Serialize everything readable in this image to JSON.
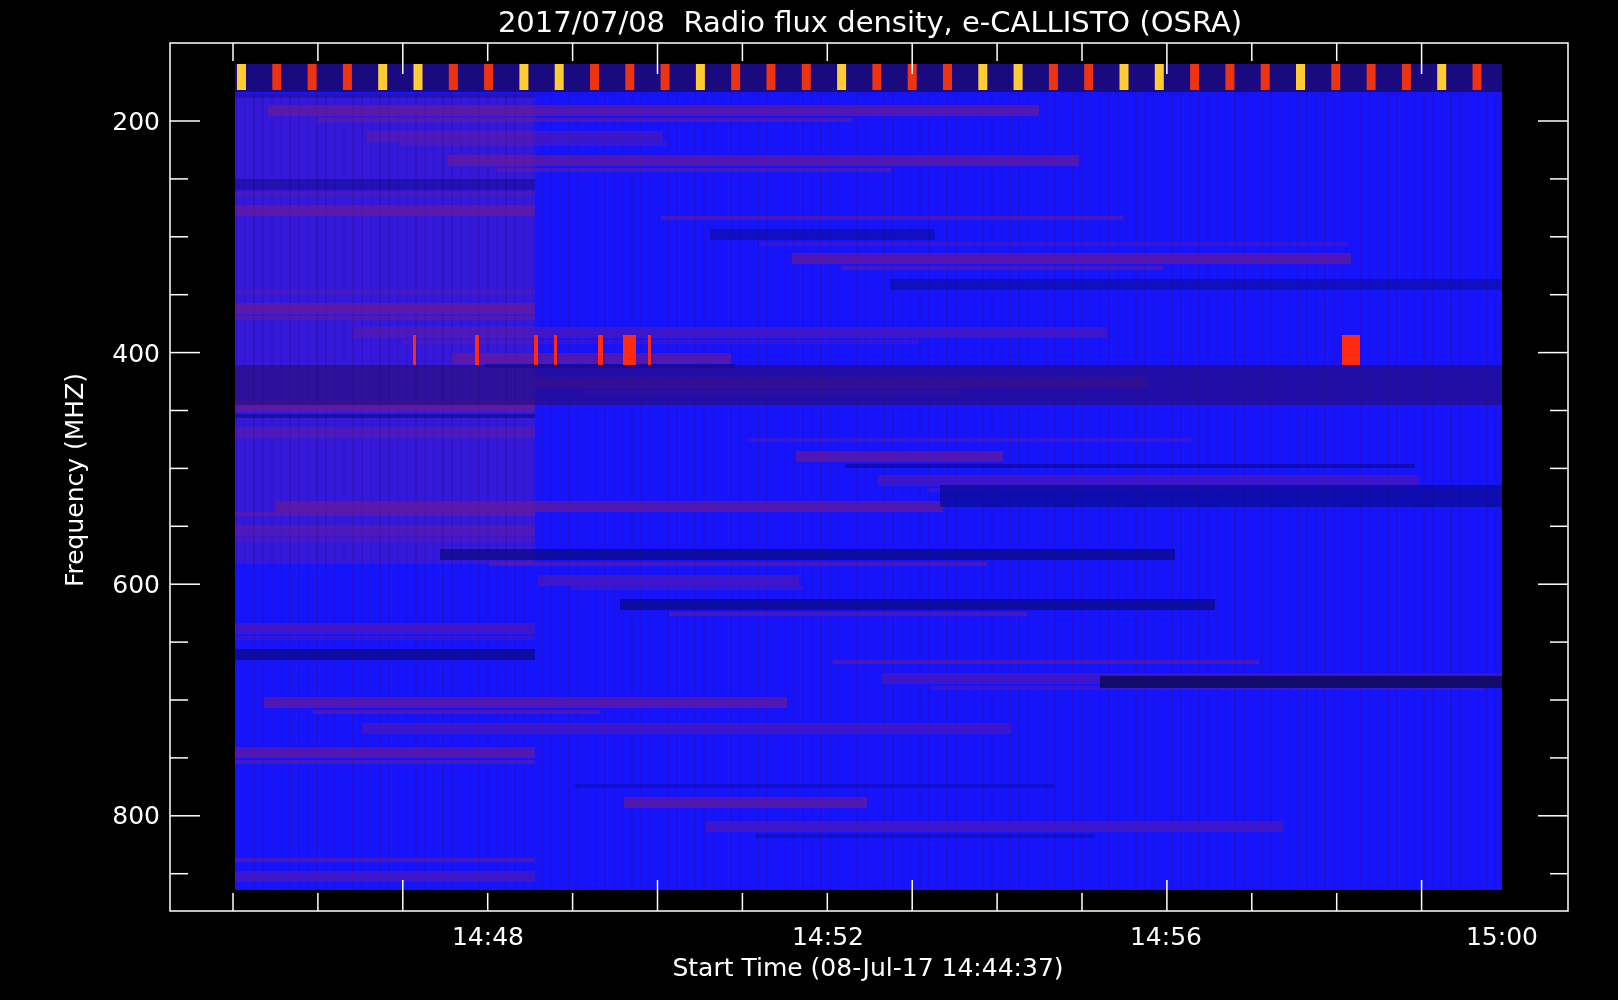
{
  "title": "2017/07/08  Radio flux density, e-CALLISTO (OSRA)",
  "xlabel": "Start Time (08-Jul-17 14:44:37)",
  "ylabel": "Frequency (MHZ)",
  "yticks": [
    "200",
    "400",
    "600",
    "800"
  ],
  "xticks": [
    "14:48",
    "14:52",
    "14:56",
    "15:00"
  ]
}
